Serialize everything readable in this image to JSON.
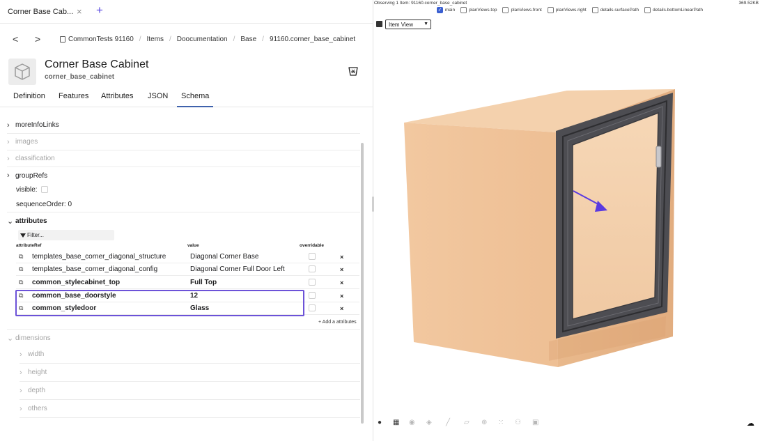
{
  "tab": {
    "title": "Corner Base Cab...",
    "close": "×",
    "new": "+"
  },
  "nav": {
    "back": "<",
    "forward": ">"
  },
  "breadcrumb": [
    "CommonTests 91160",
    "Items",
    "Doocumentation",
    "Base",
    "91160.corner_base_cabinet"
  ],
  "breadcrumb_sep": "/",
  "item": {
    "title": "Corner Base Cabinet",
    "id": "corner_base_cabinet"
  },
  "tabs": [
    "Definition",
    "Features",
    "Attributes",
    "JSON",
    "Schema"
  ],
  "active_tab": "Schema",
  "tree": {
    "moreInfoLinks": "moreInfoLinks",
    "images": "images",
    "classification": "classification",
    "groupRefs": "groupRefs",
    "visible_label": "visible:",
    "sequenceOrder_label": "sequenceOrder:",
    "sequenceOrder_value": "0",
    "attributes": "attributes",
    "dimensions": "dimensions",
    "width": "width",
    "height": "height",
    "depth": "depth",
    "others": "others"
  },
  "filter": {
    "placeholder": "Filter..."
  },
  "table": {
    "headers": [
      "attributeRef",
      "value",
      "overridable"
    ],
    "rows": [
      {
        "ref": "templates_base_corner_diagonal_structure",
        "value": "Diagonal Corner Base",
        "x": "×"
      },
      {
        "ref": "templates_base_corner_diagonal_config",
        "value": "Diagonal Corner Full Door Left",
        "x": "×"
      },
      {
        "ref": "common_stylecabinet_top",
        "value": "Full Top",
        "x": "×"
      },
      {
        "ref": "common_base_doorstyle",
        "value": "12",
        "x": "×"
      },
      {
        "ref": "common_styledoor",
        "value": "Glass",
        "x": "×"
      }
    ],
    "add_label": "+ Add a attributes"
  },
  "viewer": {
    "observing": "Observing 1 Item: 91160.corner_base_cabinet",
    "size": "369.52KB",
    "toggles": [
      {
        "label": "main",
        "checked": true
      },
      {
        "label": "planViews.top",
        "checked": false
      },
      {
        "label": "planViews.front",
        "checked": false
      },
      {
        "label": "planViews.right",
        "checked": false
      },
      {
        "label": "details.surfacePath",
        "checked": false
      },
      {
        "label": "details.bottomLinearPath",
        "checked": false
      }
    ],
    "view_select": "Item View"
  },
  "colors": {
    "accent": "#6c52d8",
    "tab_underline": "#3f62ac",
    "cabinet_front": "#f0c49c",
    "cabinet_top": "#f4cfa9",
    "cabinet_side": "#eab98e",
    "door_frame": "#4a4a4e",
    "glass": "#f3d0ac"
  }
}
